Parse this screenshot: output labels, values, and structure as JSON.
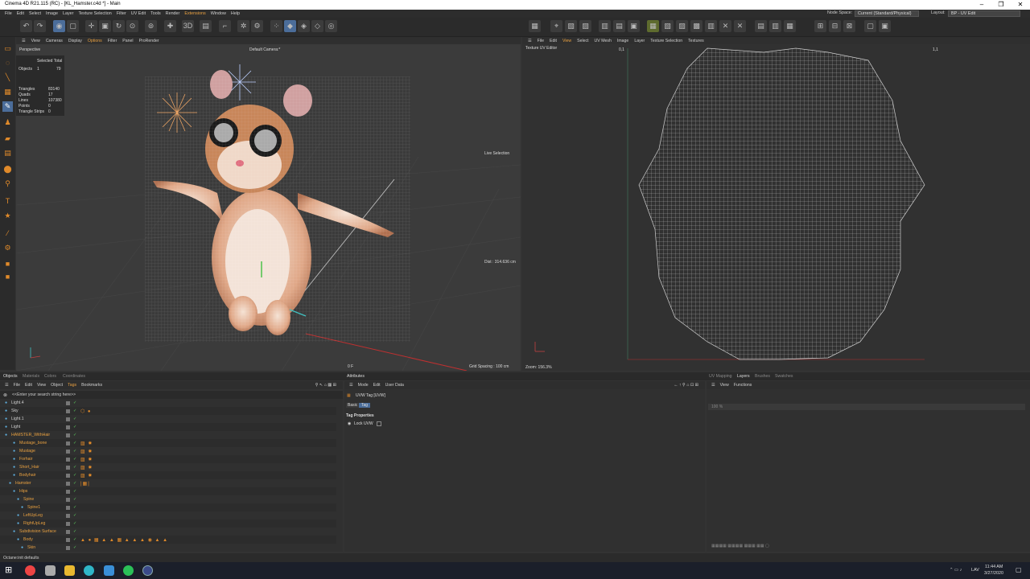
{
  "window": {
    "title": "Cinema 4D R21.115 (RC) - [KL_Hamster.c4d *] - Main",
    "controls": [
      "–",
      "❐",
      "✕"
    ]
  },
  "menubar": {
    "items": [
      "File",
      "Edit",
      "Select",
      "Image",
      "Layer",
      "Texture Selection",
      "Filter",
      "UV Edit",
      "Tools",
      "Render",
      "Extensions",
      "Window",
      "Help"
    ],
    "node_space_label": "Node Space:",
    "node_space_value": "Current (Standard/Physical)",
    "layout_label": "Layout:",
    "layout_value": "BP - UV Edit"
  },
  "viewport": {
    "menu": [
      "View",
      "Cameras",
      "Display",
      "Options",
      "Filter",
      "Panel",
      "ProRender"
    ],
    "view_name": "Perspective",
    "camera": "Default Camera:*",
    "stats": {
      "header": "Selected Total",
      "objects_label": "Objects",
      "objects_sel": "1",
      "objects_total": "79",
      "triangles_label": "Triangles",
      "triangles": "83140",
      "quads_label": "Quads",
      "quads": "17",
      "lines_label": "Lines",
      "lines": "107380",
      "points_label": "Points",
      "points": "0",
      "strips_label": "Triangle Strips",
      "strips": "0"
    },
    "live_selection": "Live Selection",
    "dist": "Dist : 314.636 cm",
    "grid_spacing": "Grid Spacing : 100 cm",
    "frame": "0 F"
  },
  "uv": {
    "menu": [
      "File",
      "Edit",
      "View",
      "Select",
      "UV Mesh",
      "Image",
      "Layer",
      "Texture Selection",
      "Textures"
    ],
    "title": "Texture UV Editor",
    "coord_left": "0,1",
    "coord_right": "1,1",
    "zoom": "Zoom: 156.3%"
  },
  "panels": {
    "left_tabs": [
      "Objects",
      "Materials",
      "Colors",
      "Coordinates"
    ],
    "attr_tab": "Attributes",
    "right_tabs": [
      "UV Mapping",
      "Layers",
      "Brushes",
      "Swatches"
    ]
  },
  "objects": {
    "menu": [
      "File",
      "Edit",
      "View",
      "Object",
      "Tags",
      "Bookmarks"
    ],
    "search_placeholder": "<<Enter your search string here>>",
    "rows": [
      {
        "name": "Light.4",
        "indent": 0,
        "color": "#cfcfcf"
      },
      {
        "name": "Sky",
        "indent": 0,
        "color": "#cfcfcf",
        "tags": "⬡ ●"
      },
      {
        "name": "Light.1",
        "indent": 0,
        "color": "#cfcfcf"
      },
      {
        "name": "Light",
        "indent": 0,
        "color": "#cfcfcf"
      },
      {
        "name": "HAMSTER_WithHair",
        "indent": 0,
        "color": "#e8a040"
      },
      {
        "name": "Mustage_bone",
        "indent": 2,
        "color": "#e8a040",
        "tags": "▨ ✸"
      },
      {
        "name": "Mustage",
        "indent": 2,
        "color": "#e8a040",
        "tags": "▨ ✸"
      },
      {
        "name": "Forhair",
        "indent": 2,
        "color": "#e8a040",
        "tags": "▨ ✸"
      },
      {
        "name": "Short_Hair",
        "indent": 2,
        "color": "#e8a040",
        "tags": "▨ ✸"
      },
      {
        "name": "Bodyhair",
        "indent": 2,
        "color": "#e8a040",
        "tags": "▨ ✸"
      },
      {
        "name": "Hamster",
        "indent": 1,
        "color": "#e8a040",
        "tags": "|▦|"
      },
      {
        "name": "Hips",
        "indent": 2,
        "color": "#e8a040"
      },
      {
        "name": "Spine",
        "indent": 3,
        "color": "#e8a040"
      },
      {
        "name": "Spine1",
        "indent": 4,
        "color": "#e8a040"
      },
      {
        "name": "LeftUpLeg",
        "indent": 3,
        "color": "#e8a040"
      },
      {
        "name": "RightUpLeg",
        "indent": 3,
        "color": "#e8a040"
      },
      {
        "name": "Subdivision Surface",
        "indent": 2,
        "color": "#e8a040"
      },
      {
        "name": "Body",
        "indent": 3,
        "color": "#e8a040",
        "tags": "▲ ● ▦ ▲ ▲ ▦ ▲ ▲ ▲ ◉ ▲ ▲"
      },
      {
        "name": "Skin",
        "indent": 4,
        "color": "#e8a040"
      }
    ]
  },
  "attributes": {
    "menu": [
      "Mode",
      "Edit",
      "User Data"
    ],
    "tag_title": "UVW Tag [UVW]",
    "tabs": [
      "Basic",
      "Tag"
    ],
    "section": "Tag Properties",
    "lock_label": "Lock UVW"
  },
  "layers": {
    "menu": [
      "View",
      "Functions"
    ],
    "opacity": "100 %"
  },
  "status": {
    "text": "Octane:init defaults"
  },
  "taskbar": {
    "lang": "LAV",
    "time": "11:44 AM",
    "date": "3/27/2020"
  },
  "colors": {
    "accent": "#e08a2a",
    "highlight": "#5e6b2e",
    "select": "#4b6d9a"
  }
}
